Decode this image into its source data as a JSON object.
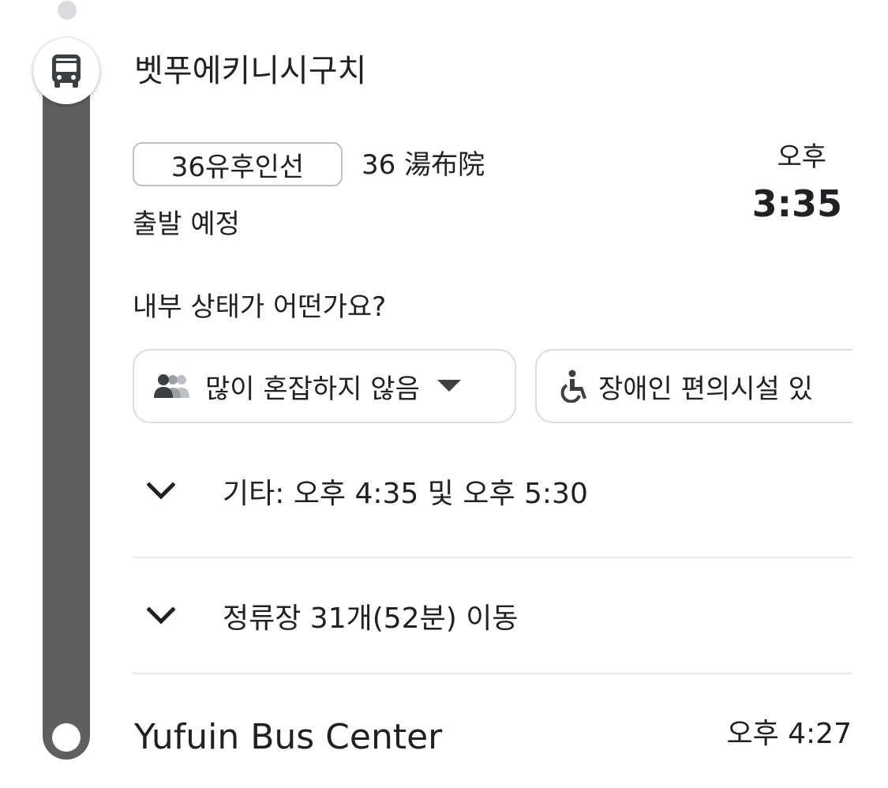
{
  "stop": {
    "name": "벳푸에키니시구치",
    "icon": "bus-icon"
  },
  "route": {
    "badge_label": "36유후인선",
    "destination": "36 湯布院",
    "status": "출발 예정"
  },
  "departure": {
    "ampm": "오후",
    "time": "3:35"
  },
  "crowding": {
    "question": "내부 상태가 어떤가요?",
    "chips": [
      {
        "label": "많이 혼잡하지 않음",
        "icon": "people-icon",
        "trailing_icon": "dropdown-arrow-icon"
      },
      {
        "label": "장애인 편의시설 있",
        "icon": "wheelchair-icon"
      }
    ]
  },
  "other_times": {
    "label": "기타: 오후 4:35 및 오후 5:30",
    "icon": "chevron-down-icon"
  },
  "stops_summary": {
    "label": "정류장 31개(52분) 이동",
    "icon": "chevron-down-icon"
  },
  "destination": {
    "name": "Yufuin Bus Center",
    "arrival": "오후 4:27"
  },
  "colors": {
    "rail": "#5f5f5f",
    "chip_border": "#dadce0",
    "divider": "#e8eaed",
    "text": "#202124"
  }
}
